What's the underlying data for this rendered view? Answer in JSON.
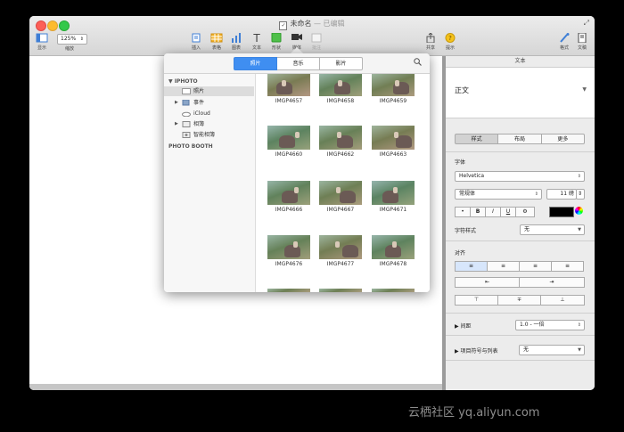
{
  "window": {
    "title": "未命名",
    "title_suffix": "— 已编辑",
    "zoom_value": "125%",
    "zoom_label": "缩放",
    "view_label": "显示"
  },
  "toolbar": {
    "insert": "插入",
    "table": "表格",
    "chart": "图表",
    "text": "文本",
    "shape": "形状",
    "media": "媒体",
    "comment": "批注",
    "share": "共享",
    "tips": "提示",
    "format": "格式",
    "document": "文稿"
  },
  "media_browser": {
    "tabs": [
      "照片",
      "音乐",
      "影片"
    ],
    "sources": {
      "group1": "IPHOTO",
      "items": [
        "照片",
        "事件",
        "iCloud",
        "相簿",
        "智能相簿"
      ],
      "group2": "PHOTO BOOTH"
    },
    "photos": [
      "IMGP4657",
      "IMGP4658",
      "IMGP4659",
      "IMGP4660",
      "IMGP4662",
      "IMGP4663",
      "IMGP4666",
      "IMGP4667",
      "IMGP4671",
      "IMGP4676",
      "IMGP4677",
      "IMGP4678"
    ]
  },
  "inspector": {
    "header": "文本",
    "paragraph_style": "正文",
    "tabs": [
      "样式",
      "布局",
      "更多"
    ],
    "font_label": "字体",
    "font_family": "Helvetica",
    "font_style": "常规体",
    "font_size": "11",
    "font_size_unit": "磅",
    "char_style_label": "字符样式",
    "char_style_value": "无",
    "alignment_label": "对齐",
    "spacing_label": "间距",
    "spacing_value": "1.0 - 一倍",
    "bullets_label": "项目符号与列表",
    "bullets_value": "无",
    "format_buttons": [
      "•",
      "B",
      "I",
      "U",
      "⚙"
    ]
  },
  "colors": {
    "accent": "#3f8ef1",
    "text_color_swatch": "#000000"
  },
  "watermark": "云栖社区 yq.aliyun.com"
}
